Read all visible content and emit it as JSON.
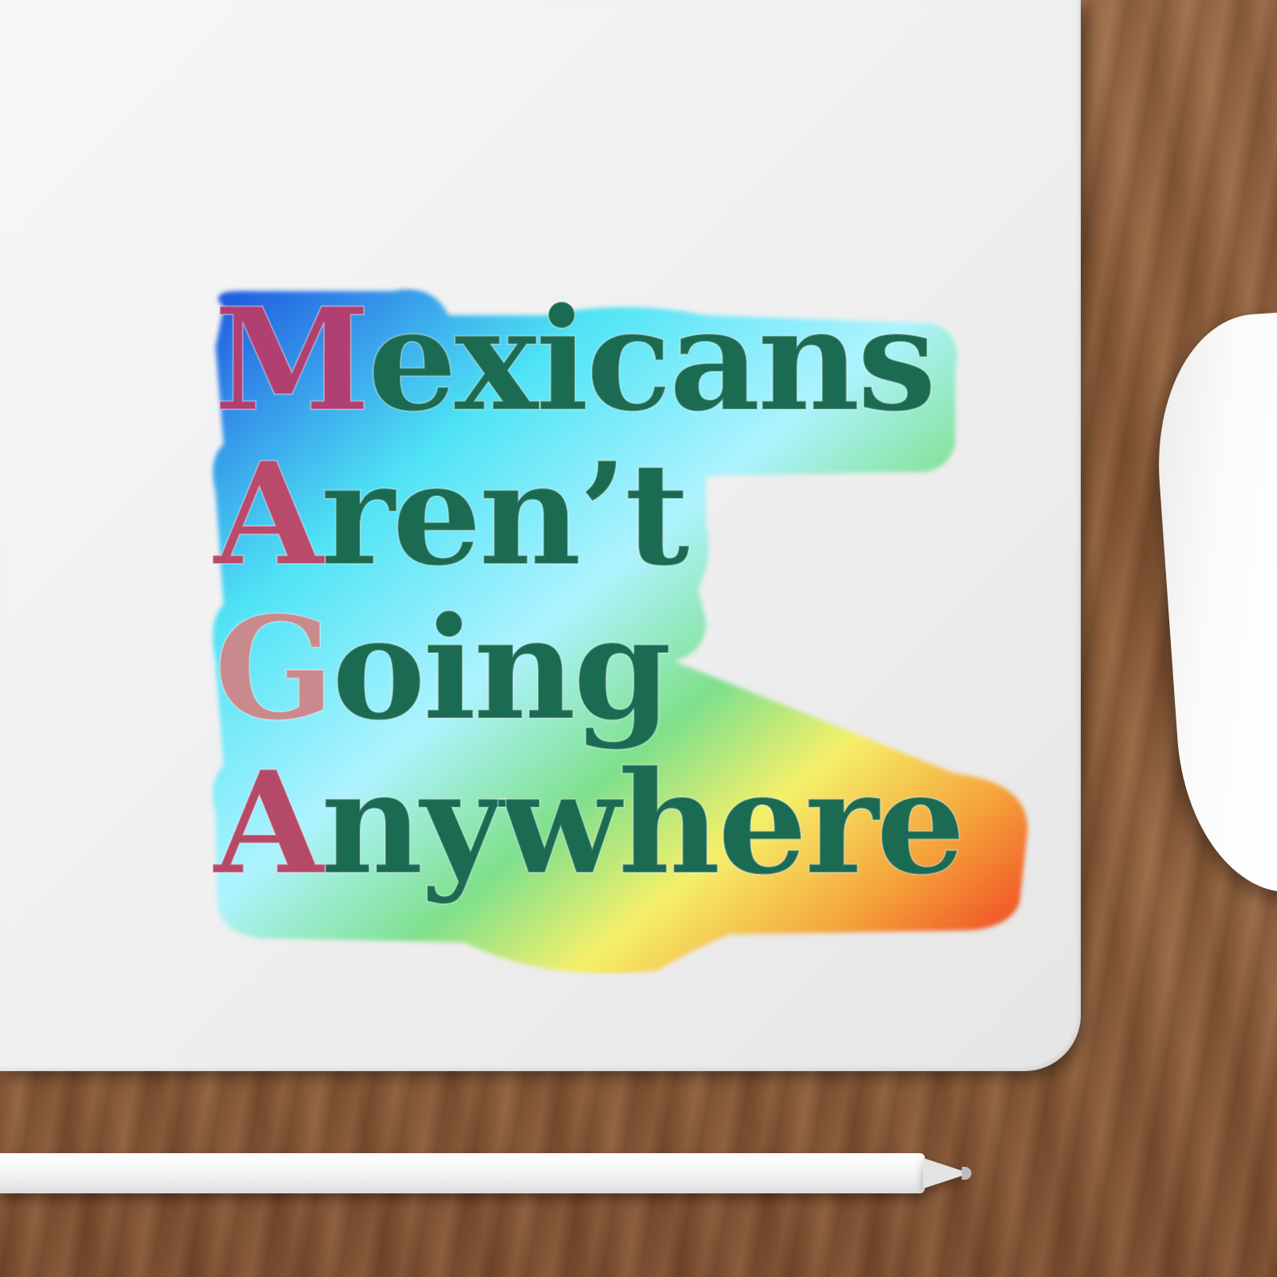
{
  "scene": {
    "objects": [
      "laptop-lid",
      "mouse-icon",
      "stylus-pencil",
      "wooden-desk"
    ]
  },
  "sticker": {
    "lines": [
      {
        "initial": "M",
        "rest": "exicans"
      },
      {
        "initial": "A",
        "rest": "ren’t"
      },
      {
        "initial": "G",
        "rest": "oing"
      },
      {
        "initial": "A",
        "rest": "nywhere"
      }
    ]
  },
  "colors": {
    "initials": "#b03f72",
    "text": "#1b6b53",
    "holo_blue": "#1f63e0",
    "holo_cyan": "#4fe3f5",
    "holo_yellow": "#f5f06a",
    "holo_red": "#f0321e"
  }
}
